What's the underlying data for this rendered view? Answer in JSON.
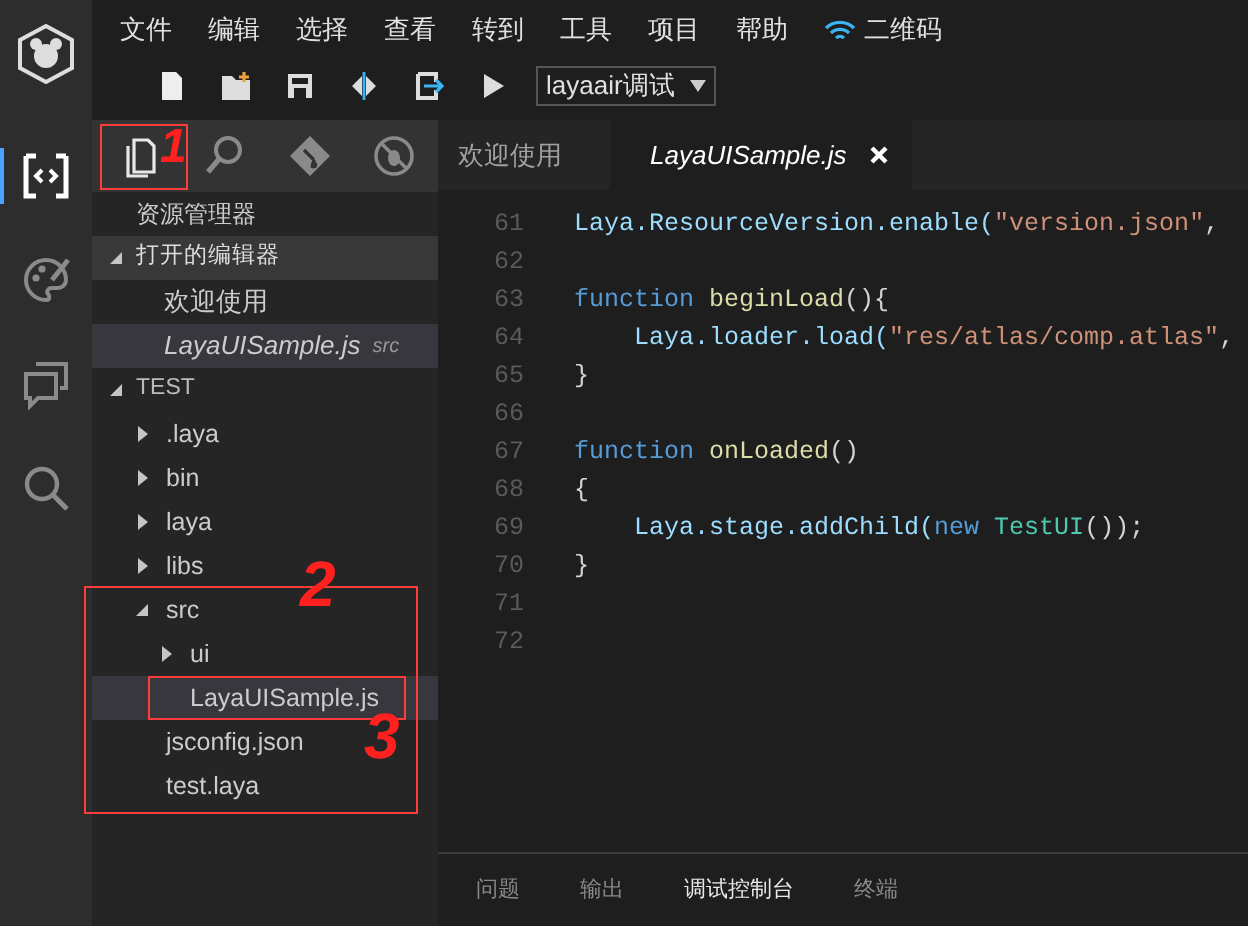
{
  "menu": [
    "文件",
    "编辑",
    "选择",
    "查看",
    "转到",
    "工具",
    "项目",
    "帮助"
  ],
  "qr_label": "二维码",
  "launch_config": "layaair调试",
  "activity_bar": [
    {
      "kind": "code",
      "selected": true
    },
    {
      "kind": "palette",
      "selected": false
    },
    {
      "kind": "chat",
      "selected": false
    },
    {
      "kind": "search",
      "selected": false
    }
  ],
  "sidebar_tabs": [
    {
      "kind": "files",
      "selected": true
    },
    {
      "kind": "search",
      "selected": false
    },
    {
      "kind": "git",
      "selected": false
    },
    {
      "kind": "debug",
      "selected": false
    }
  ],
  "sidebar_title": "资源管理器",
  "open_editors": {
    "title": "打开的编辑器",
    "expanded": true,
    "items": [
      {
        "label": "欢迎使用",
        "preview": false,
        "selected": false
      },
      {
        "label": "LayaUISample.js",
        "hint": "src",
        "preview": true,
        "selected": true
      }
    ]
  },
  "project": {
    "title": "TEST",
    "expanded": true,
    "tree": [
      {
        "label": ".laya",
        "kind": "folder",
        "expanded": false,
        "selected": false
      },
      {
        "label": "bin",
        "kind": "folder",
        "expanded": false,
        "selected": false
      },
      {
        "label": "laya",
        "kind": "folder",
        "expanded": false,
        "selected": false
      },
      {
        "label": "libs",
        "kind": "folder",
        "expanded": false,
        "selected": false
      },
      {
        "label": "src",
        "kind": "folder",
        "expanded": true,
        "selected": false,
        "children": [
          {
            "label": "ui",
            "kind": "folder",
            "expanded": false,
            "selected": false
          },
          {
            "label": "LayaUISample.js",
            "kind": "file",
            "selected": true
          }
        ]
      },
      {
        "label": "jsconfig.json",
        "kind": "file",
        "selected": false
      },
      {
        "label": "test.laya",
        "kind": "file",
        "selected": false
      }
    ]
  },
  "editor_tabs": [
    {
      "label": "欢迎使用",
      "preview": false,
      "selected": false
    },
    {
      "label": "LayaUISample.js",
      "preview": true,
      "selected": true
    }
  ],
  "code": [
    {
      "number": "61",
      "tokens": [
        {
          "kind": "id",
          "text": "Laya.ResourceVersion.enable("
        },
        {
          "kind": "string",
          "text": "\"version.json\""
        },
        {
          "kind": "punct",
          "text": ","
        }
      ]
    },
    {
      "number": "62"
    },
    {
      "number": "63",
      "tokens": [
        {
          "kind": "keyword",
          "text": "function "
        },
        {
          "kind": "func",
          "text": "beginLoad"
        },
        {
          "kind": "punct",
          "text": "(){"
        }
      ]
    },
    {
      "number": "64",
      "tokens": [
        {
          "kind": "id",
          "text": "    Laya.loader.load("
        },
        {
          "kind": "string",
          "text": "\"res/atlas/comp.atlas\""
        },
        {
          "kind": "punct",
          "text": ","
        }
      ]
    },
    {
      "number": "65",
      "tokens": [
        {
          "kind": "punct",
          "text": "}"
        }
      ]
    },
    {
      "number": "66"
    },
    {
      "number": "67",
      "tokens": [
        {
          "kind": "keyword",
          "text": "function "
        },
        {
          "kind": "func",
          "text": "onLoaded"
        },
        {
          "kind": "punct",
          "text": "()"
        }
      ]
    },
    {
      "number": "68",
      "tokens": [
        {
          "kind": "punct",
          "text": "{"
        }
      ]
    },
    {
      "number": "69",
      "tokens": [
        {
          "kind": "id",
          "text": "    Laya.stage.addChild("
        },
        {
          "kind": "keyword",
          "text": "new "
        },
        {
          "kind": "type",
          "text": "TestUI"
        },
        {
          "kind": "punct",
          "text": "());"
        }
      ]
    },
    {
      "number": "70",
      "tokens": [
        {
          "kind": "punct",
          "text": "}"
        }
      ]
    },
    {
      "number": "71"
    },
    {
      "number": "72"
    }
  ],
  "panel_tabs": [
    {
      "label": "问题",
      "selected": false
    },
    {
      "label": "输出",
      "selected": false
    },
    {
      "label": "调试控制台",
      "selected": true
    },
    {
      "label": "终端",
      "selected": false
    }
  ],
  "annotations": [
    {
      "label": "1"
    },
    {
      "label": "2"
    },
    {
      "label": "3"
    }
  ]
}
